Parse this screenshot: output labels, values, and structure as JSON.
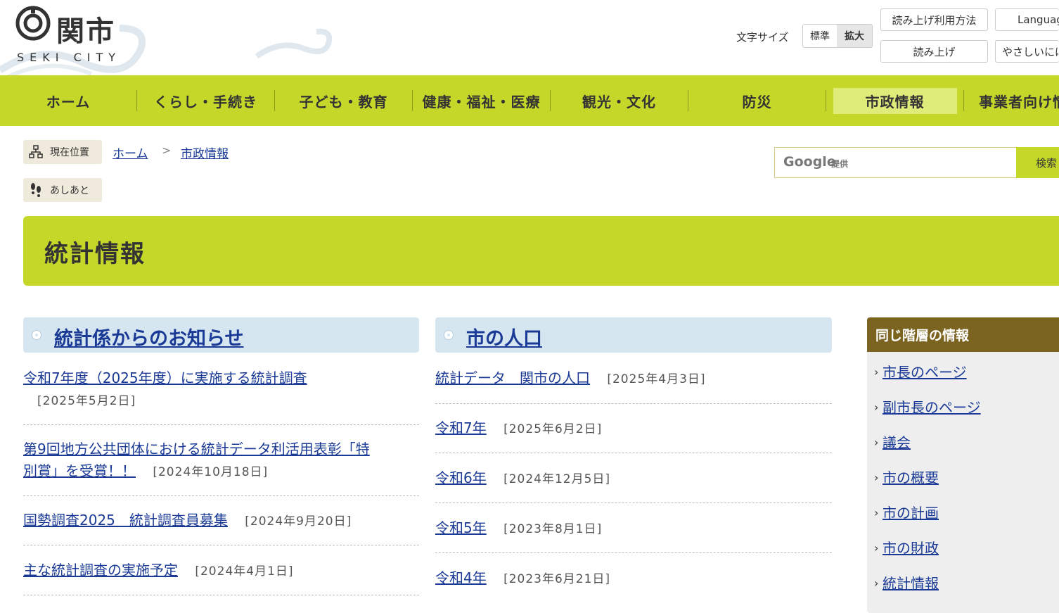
{
  "header": {
    "logo_text": "関市",
    "logo_sub": "SEKI CITY",
    "fontsize_label": "文字サイズ",
    "fontsize_normal": "標準",
    "fontsize_large": "拡大",
    "readaloud_howto": "読み上げ利用方法",
    "readaloud": "読み上げ",
    "language": "Language",
    "easy_japanese": "やさしいにほんご"
  },
  "nav": {
    "items": [
      {
        "label": "ホーム"
      },
      {
        "label": "くらし・手続き"
      },
      {
        "label": "子ども・教育"
      },
      {
        "label": "健康・福祉・医療"
      },
      {
        "label": "観光・文化"
      },
      {
        "label": "防災"
      },
      {
        "label": "市政情報"
      },
      {
        "label": "事業者向け情報"
      }
    ],
    "current_index": 6
  },
  "breadcrumb": {
    "tag_label": "現在位置",
    "items": [
      "ホーム",
      "市政情報"
    ],
    "separator": ">",
    "history_label": "あしあと"
  },
  "search": {
    "google_label": "Google",
    "google_sub": "提供",
    "placeholder": "",
    "button": "検索"
  },
  "page_title": "統計情報",
  "notices": {
    "heading": "統計係からのお知らせ",
    "items": [
      {
        "title": "令和7年度（2025年度）に実施する統計調査",
        "date": "[2025年5月2日]"
      },
      {
        "title_line1": "第9回地方公共団体における統計データ利活用表彰「特",
        "title_line2": "別賞」を受賞！！",
        "date": "[2024年10月18日]"
      },
      {
        "title": "国勢調査2025　統計調査員募集",
        "date": "[2024年9月20日]"
      },
      {
        "title": "主な統計調査の実施予定",
        "date": "[2024年4月1日]"
      }
    ]
  },
  "population": {
    "heading": "市の人口",
    "items": [
      {
        "title": "統計データ　関市の人口",
        "date": "[2025年4月3日]"
      },
      {
        "title": "令和7年",
        "date": "[2025年6月2日]"
      },
      {
        "title": "令和6年",
        "date": "[2024年12月5日]"
      },
      {
        "title": "令和5年",
        "date": "[2023年8月1日]"
      },
      {
        "title": "令和4年",
        "date": "[2023年6月21日]"
      }
    ]
  },
  "sidebar": {
    "heading": "同じ階層の情報",
    "items": [
      {
        "label": "市長のページ"
      },
      {
        "label": "副市長のページ"
      },
      {
        "label": "議会"
      },
      {
        "label": "市の概要"
      },
      {
        "label": "市の計画"
      },
      {
        "label": "市の財政"
      },
      {
        "label": "統計情報"
      }
    ]
  },
  "colors": {
    "nav_green": "#c5d82a",
    "link_blue": "#1a3a96",
    "sidebar_brown": "#7a6420",
    "column_head_blue": "#d5e6f1"
  }
}
